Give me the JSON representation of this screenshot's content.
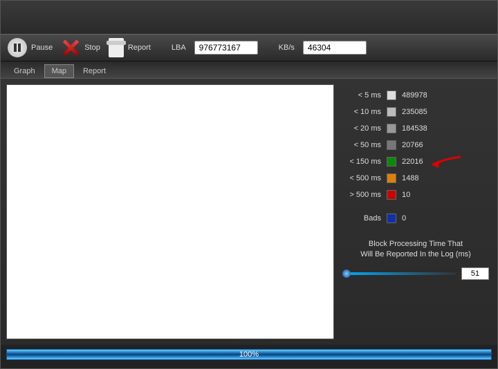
{
  "toolbar": {
    "pause": "Pause",
    "stop": "Stop",
    "report": "Report",
    "lba_label": "LBA",
    "lba_value": "976773167",
    "kbs_label": "KB/s",
    "kbs_value": "46304"
  },
  "tabs": {
    "graph": "Graph",
    "map": "Map",
    "report": "Report"
  },
  "legend": [
    {
      "label": "< 5 ms",
      "color": "#dddddd",
      "count": "489978"
    },
    {
      "label": "< 10 ms",
      "color": "#bbbbbb",
      "count": "235085"
    },
    {
      "label": "< 20 ms",
      "color": "#999999",
      "count": "184538"
    },
    {
      "label": "< 50 ms",
      "color": "#777777",
      "count": "20766"
    },
    {
      "label": "< 150 ms",
      "color": "#0a8a0a",
      "count": "22016"
    },
    {
      "label": "< 500 ms",
      "color": "#e08000",
      "count": "1488"
    },
    {
      "label": "> 500 ms",
      "color": "#cc0000",
      "count": "10"
    }
  ],
  "bads": {
    "label": "Bads",
    "color": "#1030aa",
    "count": "0"
  },
  "slider": {
    "text1": "Block Processing Time That",
    "text2": "Will Be Reported In the Log (ms)",
    "value": "51"
  },
  "progress": "100%"
}
